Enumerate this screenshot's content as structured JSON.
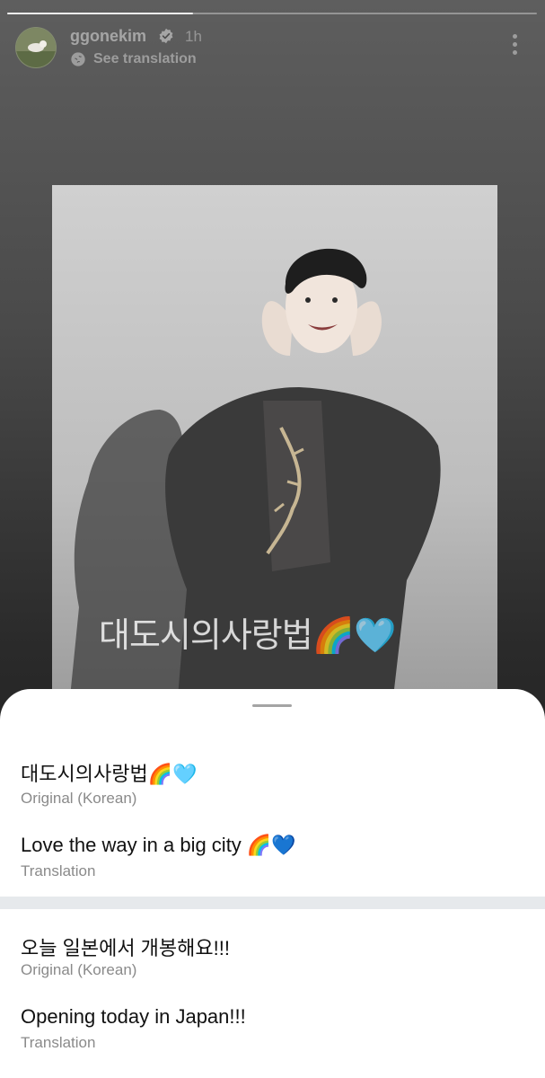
{
  "post": {
    "username": "ggonekim",
    "time": "1h",
    "see_translation": "See translation",
    "overlay_caption": "대도시의사랑법🌈🩵"
  },
  "icons": {
    "verified": "verified-badge-icon",
    "translate": "globe-translate-icon",
    "more": "more-vertical-icon"
  },
  "sheet": {
    "blocks": [
      {
        "original": "대도시의사랑법🌈🩵",
        "original_label": "Original (Korean)",
        "translation": "Love the way in a big city 🌈💙",
        "translation_label": "Translation"
      },
      {
        "original": "오늘 일본에서 개봉해요!!!",
        "original_label": "Original (Korean)",
        "translation": "Opening today in Japan!!!",
        "translation_label": "Translation"
      }
    ]
  },
  "colors": {
    "sheet_bg": "#ffffff",
    "divider": "#e6e9ec",
    "primary_text": "#111111",
    "secondary_text": "#8a8a8a"
  }
}
